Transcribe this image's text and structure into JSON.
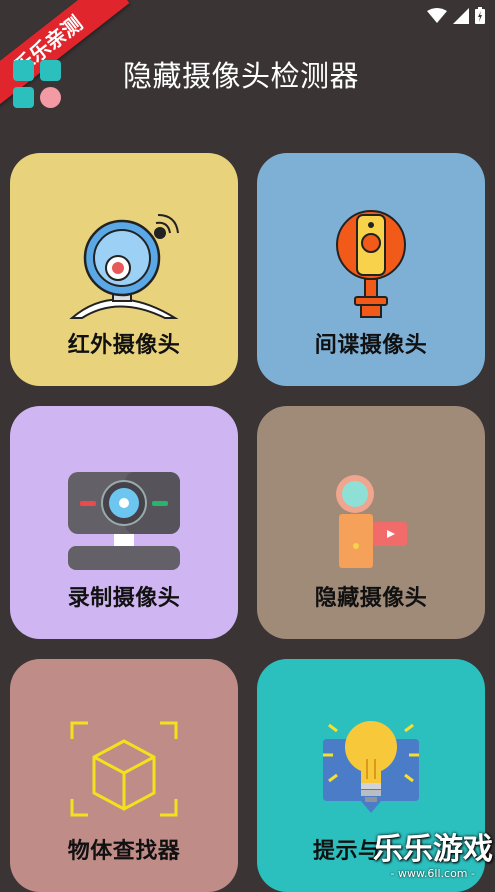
{
  "ribbon": "乐乐亲测",
  "header": {
    "title": "隐藏摄像头检测器"
  },
  "colors": {
    "background": "#3a3435",
    "infrared": "#e9d27c",
    "spy": "#7eb0d6",
    "record": "#cfb6f2",
    "hidden": "#a08a78",
    "object": "#c08c88",
    "tips": "#2bbfbd"
  },
  "cards": [
    {
      "label": "红外摄像头",
      "icon": "webcam-icon"
    },
    {
      "label": "间谍摄像头",
      "icon": "spy-camera-icon"
    },
    {
      "label": "录制摄像头",
      "icon": "desktop-camera-icon"
    },
    {
      "label": "隐藏摄像头",
      "icon": "camcorder-icon"
    },
    {
      "label": "物体查找器",
      "icon": "cube-scan-icon"
    },
    {
      "label": "提示与",
      "icon": "lightbulb-icon"
    }
  ],
  "watermark": {
    "main": "乐乐游戏",
    "sub": "- www.6ll.com -"
  }
}
